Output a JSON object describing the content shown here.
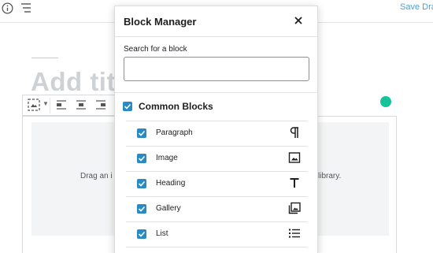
{
  "topbar": {
    "info_icon": "info-icon",
    "list_icon": "list-view-icon",
    "save_draft_label": "Save Draf"
  },
  "editor": {
    "title_placeholder": "Add titl",
    "placeholder_text_left": "Drag an i",
    "placeholder_text_right": "library."
  },
  "modal": {
    "title": "Block Manager",
    "close_icon": "close-icon",
    "search": {
      "label": "Search for a block",
      "value": "",
      "placeholder": ""
    },
    "category": {
      "label": "Common Blocks",
      "checked": true
    },
    "blocks": [
      {
        "label": "Paragraph",
        "icon": "paragraph-icon",
        "checked": true
      },
      {
        "label": "Image",
        "icon": "image-icon",
        "checked": true
      },
      {
        "label": "Heading",
        "icon": "heading-icon",
        "checked": true
      },
      {
        "label": "Gallery",
        "icon": "gallery-icon",
        "checked": true
      },
      {
        "label": "List",
        "icon": "list-icon",
        "checked": true
      }
    ]
  },
  "colors": {
    "accent": "#2a8ac4",
    "link": "#4b9fd6",
    "grammarly": "#15c39a"
  }
}
